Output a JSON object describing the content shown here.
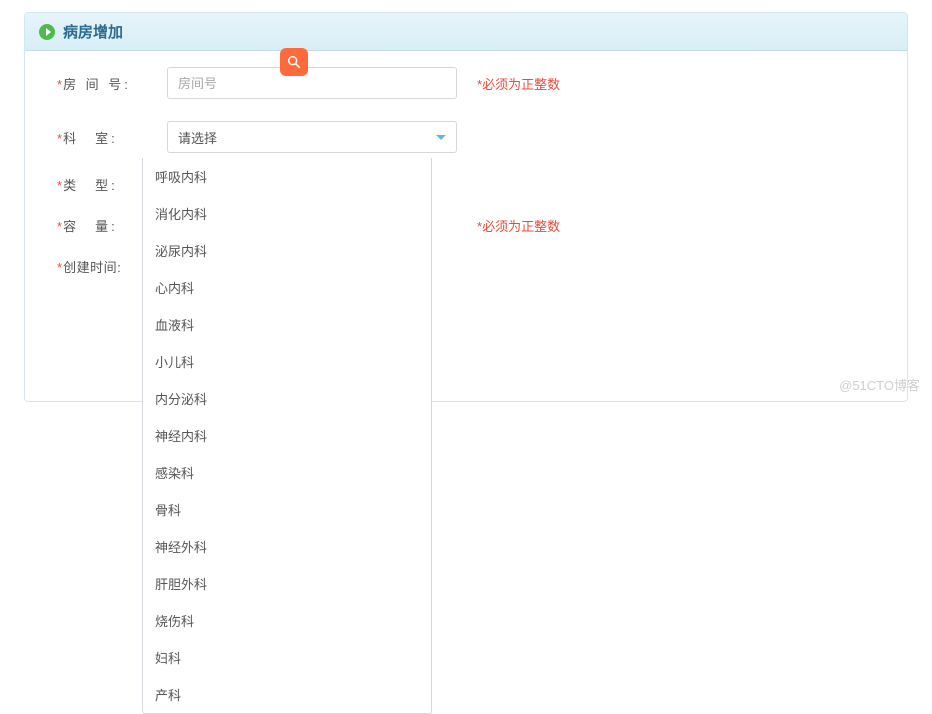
{
  "panel": {
    "title": "病房增加"
  },
  "fields": {
    "room_number": {
      "label": "房 间 号:",
      "placeholder": "房间号",
      "value": ""
    },
    "department": {
      "label": "科　室:",
      "selected": "请选择"
    },
    "type": {
      "label": "类　型:"
    },
    "capacity": {
      "label": "容　量:"
    },
    "created": {
      "label": "创建时间:"
    }
  },
  "hints": {
    "room_number": "必须为正整数",
    "capacity": "必须为正整数"
  },
  "dropdown_options": [
    "呼吸内科",
    "消化内科",
    "泌尿内科",
    "心内科",
    "血液科",
    "小儿科",
    "内分泌科",
    "神经内科",
    "感染科",
    "骨科",
    "神经外科",
    "肝胆外科",
    "烧伤科",
    "妇科",
    "产科"
  ],
  "watermark": "@51CTO博客"
}
